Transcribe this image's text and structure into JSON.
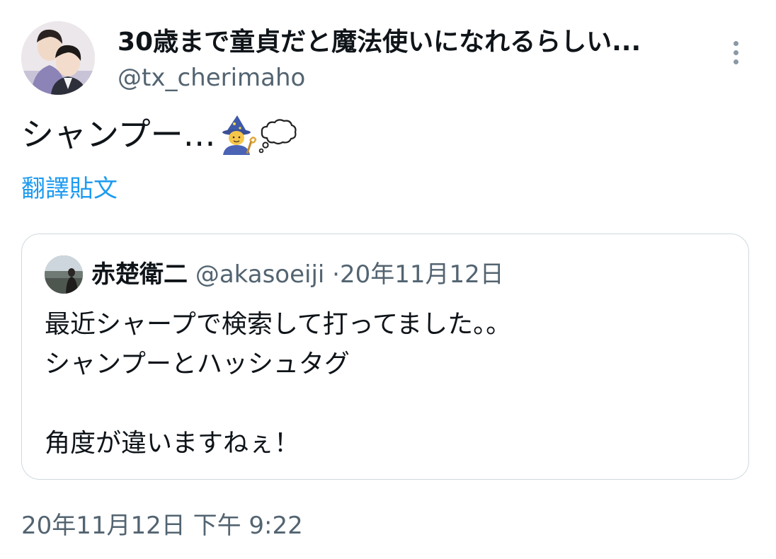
{
  "author": {
    "display_name": "30歳まで童貞だと魔法使いになれるらしい...",
    "handle": "@tx_cherimaho",
    "avatar": "profile-photo-two-men"
  },
  "more_icon": "more-vertical-icon",
  "tweet": {
    "text": "シャンプー…",
    "emojis": [
      "mage-emoji",
      "thought-balloon-emoji"
    ],
    "translate_label": "翻譯貼文",
    "timestamp": "20年11月12日 下午 9:22"
  },
  "quote": {
    "avatar": "profile-photo-person-outdoors",
    "name": "赤楚衛二",
    "handle": "@akasoeiji",
    "separator": "·",
    "date": "20年11月12日",
    "lines": [
      "最近シャープで検索して打ってました。。",
      "シャンプーとハッシュタグ",
      "",
      "角度が違いますねぇ！"
    ]
  },
  "colors": {
    "text": "#0f1419",
    "secondary": "#536471",
    "link": "#1d9bf0",
    "border": "#cfd9de"
  }
}
